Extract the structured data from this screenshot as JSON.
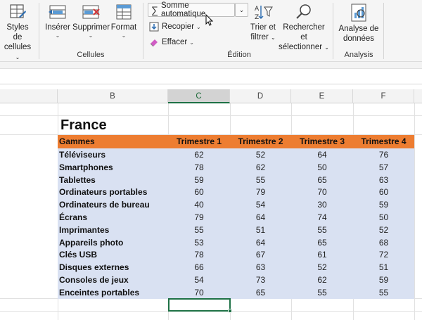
{
  "ribbon": {
    "styles_cellules": {
      "line1": "Styles de",
      "line2": "cellules"
    },
    "cellules_group": {
      "inserer": "Insérer",
      "supprimer": "Supprimer",
      "format": "Format",
      "label": "Cellules"
    },
    "edition_group": {
      "somme": "Somme automatique",
      "recopier": "Recopier",
      "effacer": "Effacer",
      "trier_line1": "Trier et",
      "trier_line2": "filtrer",
      "rechercher_line1": "Rechercher et",
      "rechercher_line2": "sélectionner",
      "label": "Édition"
    },
    "analysis_group": {
      "line1": "Analyse de",
      "line2": "données",
      "label": "Analysis"
    }
  },
  "columns": [
    "B",
    "C",
    "D",
    "E",
    "F"
  ],
  "active_column": "C",
  "sheet": {
    "title": "France",
    "headers": [
      "Gammes",
      "Trimestre 1",
      "Trimestre 2",
      "Trimestre 3",
      "Trimestre 4"
    ],
    "rows": [
      {
        "name": "Téléviseurs",
        "values": [
          62,
          52,
          64,
          76
        ]
      },
      {
        "name": "Smartphones",
        "values": [
          78,
          62,
          50,
          57
        ]
      },
      {
        "name": "Tablettes",
        "values": [
          59,
          55,
          65,
          63
        ]
      },
      {
        "name": "Ordinateurs portables",
        "values": [
          60,
          79,
          70,
          60
        ]
      },
      {
        "name": "Ordinateurs de bureau",
        "values": [
          40,
          54,
          30,
          59
        ]
      },
      {
        "name": "Écrans",
        "values": [
          79,
          64,
          74,
          50
        ]
      },
      {
        "name": "Imprimantes",
        "values": [
          55,
          51,
          55,
          52
        ]
      },
      {
        "name": "Appareils photo",
        "values": [
          53,
          64,
          65,
          68
        ]
      },
      {
        "name": "Clés USB",
        "values": [
          78,
          67,
          61,
          72
        ]
      },
      {
        "name": "Disques externes",
        "values": [
          66,
          63,
          52,
          51
        ]
      },
      {
        "name": "Consoles de jeux",
        "values": [
          54,
          73,
          62,
          59
        ]
      },
      {
        "name": "Enceintes portables",
        "values": [
          70,
          65,
          55,
          55
        ]
      }
    ]
  },
  "colors": {
    "header_fill": "#ed7d31",
    "body_fill": "#d9e1f2",
    "selection": "#1e7145"
  }
}
